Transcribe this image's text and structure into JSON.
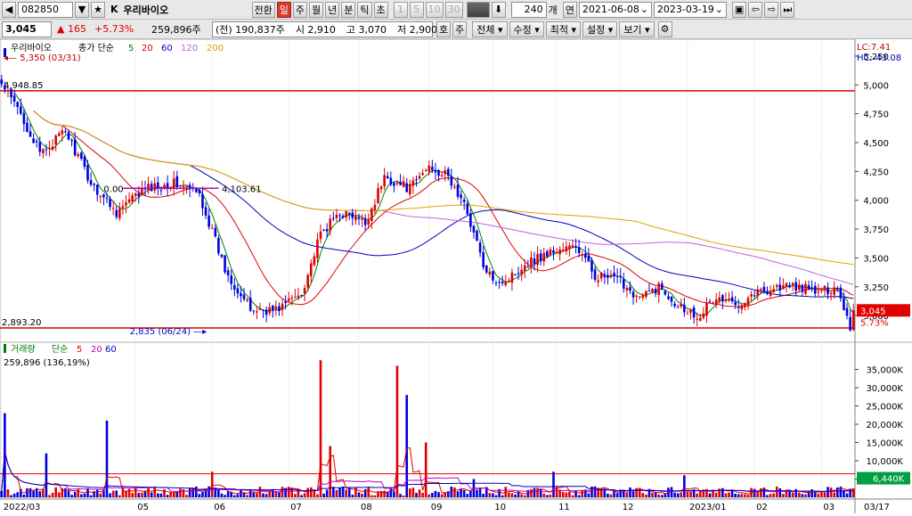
{
  "toolbar1": {
    "code": "082850",
    "market_flag": "K",
    "name": "우리바이오",
    "btn_switch": "전환",
    "periods": [
      "일",
      "주",
      "월",
      "년",
      "분",
      "틱",
      "초"
    ],
    "minutes": [
      "1",
      "5",
      "10",
      "30"
    ],
    "count": "240",
    "count_unit": "개",
    "continuous": "연",
    "start_date": "2021-06-08",
    "end_date": "2023-03-19"
  },
  "toolbar2": {
    "price": "3,045",
    "change": "▲ 165",
    "change_pct": "+5.73%",
    "volume": "259,896주",
    "prev_volume": "(전) 190,837주",
    "open": "시 2,910",
    "high": "고 3,070",
    "low": "저 2,900",
    "quote_btn": "호",
    "stock_btn": "주",
    "menus": [
      "전체",
      "수정",
      "최적",
      "설정",
      "보기"
    ]
  },
  "price_panel": {
    "name": "우리바이오",
    "legend_title": "종가 단순",
    "ma": [
      "5",
      "20",
      "60",
      "120",
      "200"
    ],
    "ma_colors": [
      "#008000",
      "#e00000",
      "#0000c0",
      "#c060e0",
      "#e0a000"
    ],
    "max_label": "5,350 (03/31)",
    "min_label": "2,835 (06/24)",
    "hline_top": "4,948.85",
    "hline_bottom": "2,893.20",
    "fib_left": "0.00",
    "fib_right": "4,103.61",
    "lc": "LC:7.41",
    "hc": "HC:-43.08",
    "y_ticks": [
      "5,250",
      "5,000",
      "4,750",
      "4,500",
      "4,250",
      "4,000",
      "3,750",
      "3,500",
      "3,250",
      "3,000"
    ],
    "y_tick_values": [
      5250,
      5000,
      4750,
      4500,
      4250,
      4000,
      3750,
      3500,
      3250,
      3000
    ],
    "current_price": "3,045",
    "current_pct": "5.73%"
  },
  "volume_panel": {
    "legend": "거래량",
    "legend_title": "단순",
    "ma": [
      "5",
      "20",
      "60"
    ],
    "ma_colors": [
      "#e00000",
      "#c000c0",
      "#0000c0"
    ],
    "value_label": "259,896 (136,19%)",
    "y_ticks": [
      "35,000K",
      "30,000K",
      "25,000K",
      "20,000K",
      "15,000K",
      "10,000K",
      "5,000K"
    ],
    "y_tick_values": [
      35000,
      30000,
      25000,
      20000,
      15000,
      10000,
      5000
    ],
    "current_volume": "6,440K"
  },
  "x_axis": {
    "labels": [
      "2022/03",
      "05",
      "06",
      "07",
      "08",
      "09",
      "10",
      "11",
      "12",
      "2023/01",
      "02",
      "03"
    ],
    "label_at": [
      0,
      42,
      66,
      90,
      112,
      134,
      154,
      174,
      194,
      215,
      236,
      257
    ],
    "right_label": "03/17"
  },
  "chart_data": {
    "type": "candlestick",
    "ylim": [
      2800,
      5350
    ],
    "volume_ylim": [
      0,
      40000
    ],
    "hlines": [
      4948.85,
      2893.2
    ],
    "anchors": [
      {
        "day": 0,
        "price": 5000
      },
      {
        "day": 6,
        "price": 4750
      },
      {
        "day": 12,
        "price": 4400
      },
      {
        "day": 20,
        "price": 4600
      },
      {
        "day": 28,
        "price": 4150
      },
      {
        "day": 36,
        "price": 3900
      },
      {
        "day": 45,
        "price": 4100
      },
      {
        "day": 54,
        "price": 4150
      },
      {
        "day": 62,
        "price": 4050
      },
      {
        "day": 70,
        "price": 3400
      },
      {
        "day": 78,
        "price": 3050
      },
      {
        "day": 86,
        "price": 3050
      },
      {
        "day": 94,
        "price": 3200
      },
      {
        "day": 100,
        "price": 3700
      },
      {
        "day": 106,
        "price": 3900
      },
      {
        "day": 114,
        "price": 3800
      },
      {
        "day": 120,
        "price": 4200
      },
      {
        "day": 128,
        "price": 4100
      },
      {
        "day": 134,
        "price": 4300
      },
      {
        "day": 140,
        "price": 4200
      },
      {
        "day": 146,
        "price": 3900
      },
      {
        "day": 152,
        "price": 3350
      },
      {
        "day": 158,
        "price": 3300
      },
      {
        "day": 164,
        "price": 3450
      },
      {
        "day": 172,
        "price": 3550
      },
      {
        "day": 180,
        "price": 3600
      },
      {
        "day": 186,
        "price": 3350
      },
      {
        "day": 194,
        "price": 3300
      },
      {
        "day": 200,
        "price": 3150
      },
      {
        "day": 206,
        "price": 3250
      },
      {
        "day": 212,
        "price": 3100
      },
      {
        "day": 218,
        "price": 3000
      },
      {
        "day": 224,
        "price": 3150
      },
      {
        "day": 230,
        "price": 3100
      },
      {
        "day": 236,
        "price": 3200
      },
      {
        "day": 244,
        "price": 3250
      },
      {
        "day": 250,
        "price": 3250
      },
      {
        "day": 256,
        "price": 3200
      },
      {
        "day": 262,
        "price": 3250
      },
      {
        "day": 266,
        "price": 2900
      },
      {
        "day": 267,
        "price": 3045
      }
    ],
    "volume_spikes": [
      {
        "day": 1,
        "value": 23000
      },
      {
        "day": 14,
        "value": 12000
      },
      {
        "day": 33,
        "value": 21000
      },
      {
        "day": 66,
        "value": 7000
      },
      {
        "day": 100,
        "value": 37500
      },
      {
        "day": 103,
        "value": 14000
      },
      {
        "day": 124,
        "value": 36000
      },
      {
        "day": 127,
        "value": 28000
      },
      {
        "day": 133,
        "value": 15000
      },
      {
        "day": 148,
        "value": 5000
      },
      {
        "day": 173,
        "value": 7000
      },
      {
        "day": 214,
        "value": 6000
      },
      {
        "day": 226,
        "value": 2500
      }
    ]
  }
}
